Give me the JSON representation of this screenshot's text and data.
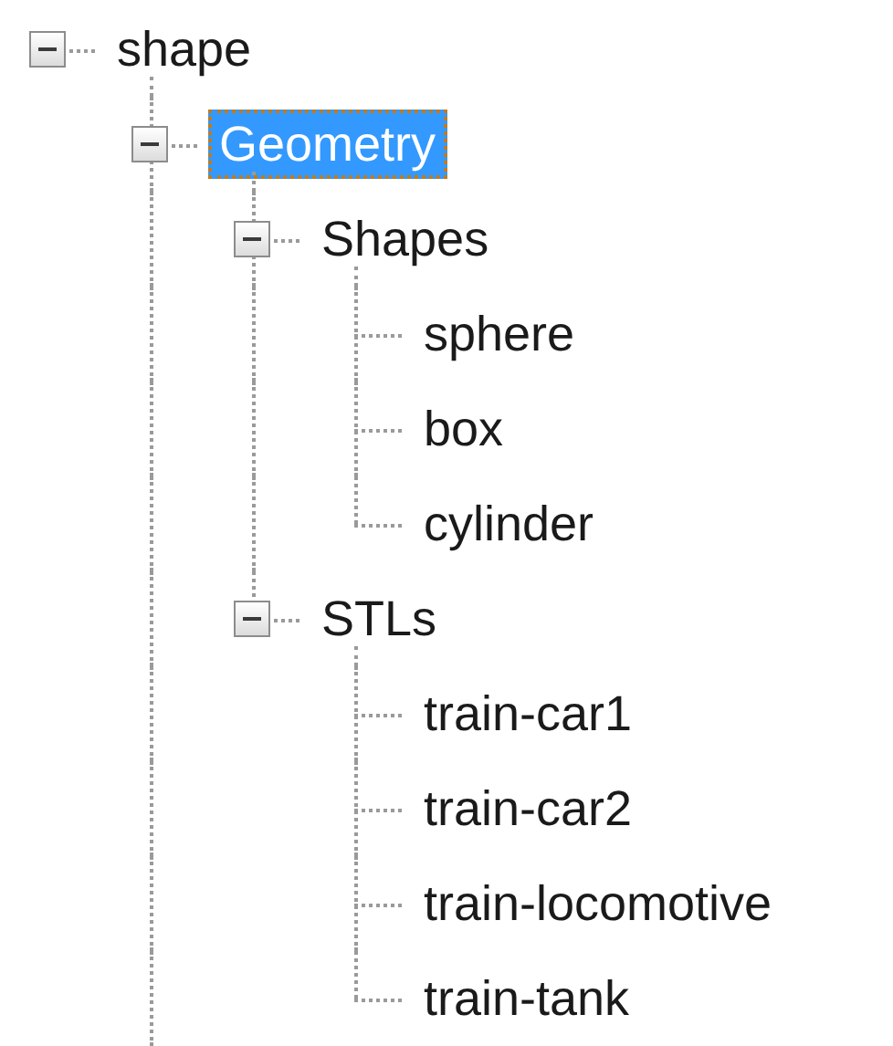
{
  "tree": {
    "label": "shape",
    "expanded": true,
    "selected": false,
    "more_children_below": true,
    "children": [
      {
        "label": "Geometry",
        "expanded": true,
        "selected": true,
        "children": [
          {
            "label": "Shapes",
            "expanded": true,
            "selected": false,
            "children": [
              {
                "label": "sphere",
                "selected": false
              },
              {
                "label": "box",
                "selected": false
              },
              {
                "label": "cylinder",
                "selected": false
              }
            ]
          },
          {
            "label": "STLs",
            "expanded": true,
            "selected": false,
            "children": [
              {
                "label": "train-car1",
                "selected": false
              },
              {
                "label": "train-car2",
                "selected": false
              },
              {
                "label": "train-locomotive",
                "selected": false
              },
              {
                "label": "train-tank",
                "selected": false
              }
            ]
          }
        ]
      }
    ]
  }
}
